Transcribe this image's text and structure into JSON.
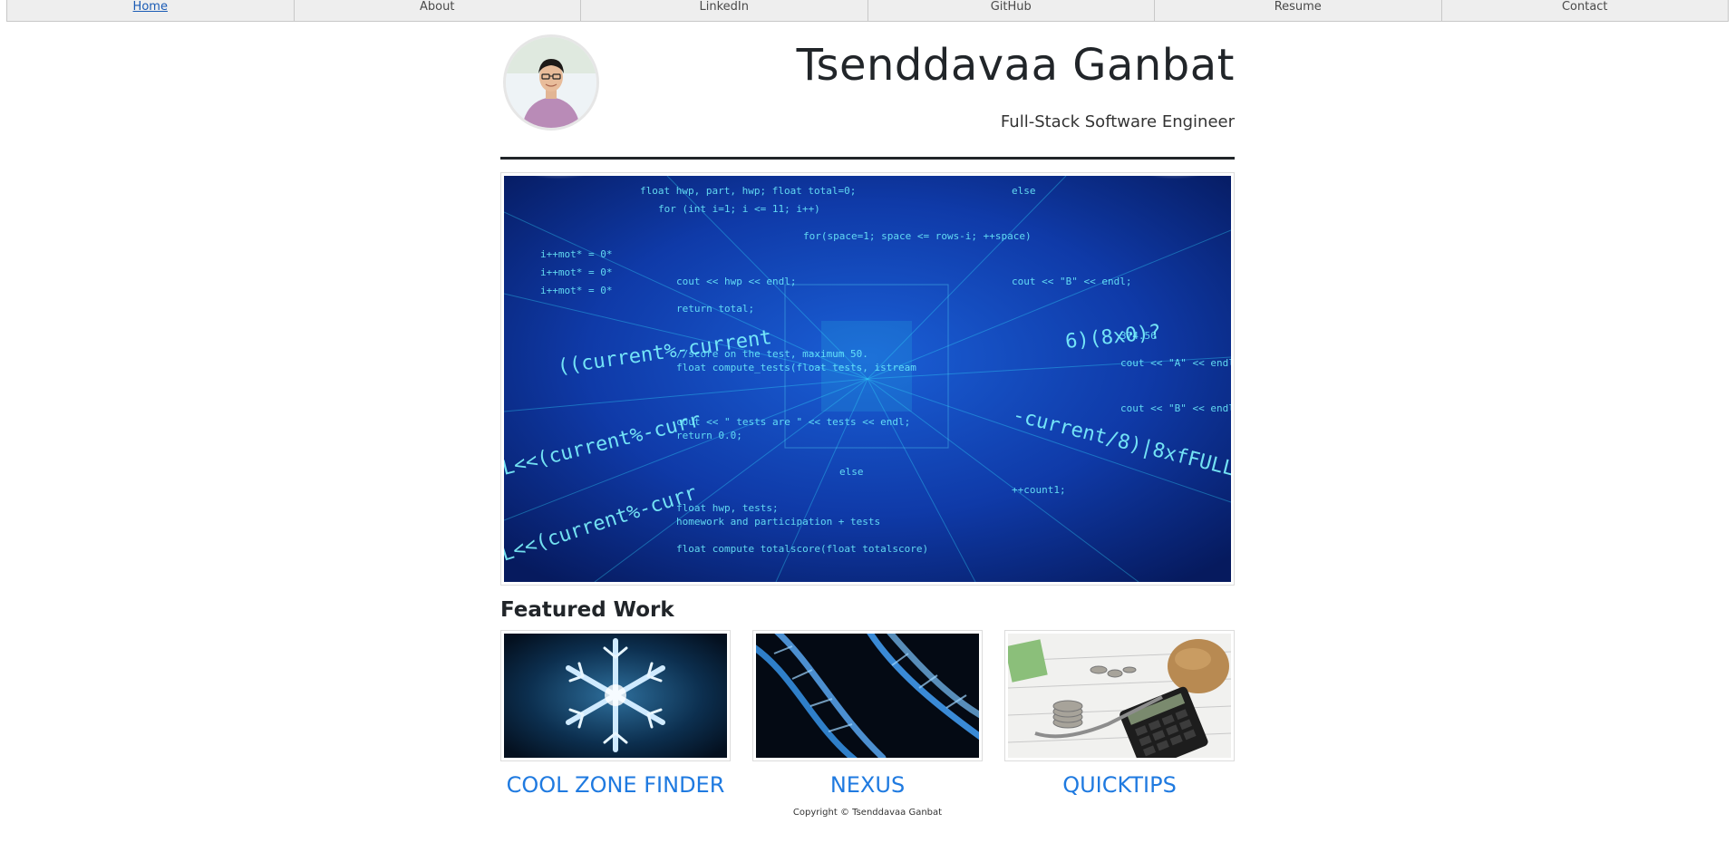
{
  "nav": {
    "items": [
      {
        "label": "Home"
      },
      {
        "label": "About"
      },
      {
        "label": "LinkedIn"
      },
      {
        "label": "GitHub"
      },
      {
        "label": "Resume"
      },
      {
        "label": "Contact"
      }
    ]
  },
  "header": {
    "name": "Tsenddavaa Ganbat",
    "subtitle": "Full-Stack Software Engineer"
  },
  "featured": {
    "title": "Featured Work",
    "works": [
      {
        "title": "COOL ZONE FINDER"
      },
      {
        "title": "NEXUS"
      },
      {
        "title": "QUICKTIPS"
      }
    ]
  },
  "footer": {
    "text": "Copyright © Tsenddavaa Ganbat"
  },
  "colors": {
    "link": "#1f7ae0",
    "nav_bg": "#eeeeee",
    "text": "#212529"
  }
}
